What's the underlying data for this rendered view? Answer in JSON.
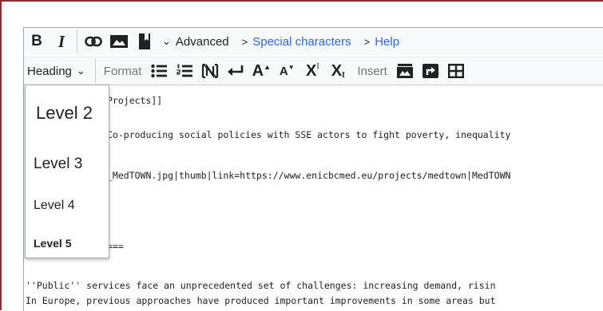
{
  "toolbar": {
    "bold_label": "B",
    "italic_label": "I",
    "advanced_label": "Advanced",
    "special_chars_label": "Special characters",
    "help_label": "Help",
    "heading_label": "Heading",
    "format_label": "Format",
    "insert_label": "Insert",
    "superscript_label": "X",
    "superscript_sup": "I",
    "subscript_label": "X",
    "subscript_sub": "I",
    "big_label": "A",
    "small_label": "A",
    "chevron_right": ">",
    "chevron_down": "⌄",
    "link_color": "#3366cc"
  },
  "heading_menu": {
    "items": [
      "Level 2",
      "Level 3",
      "Level 4",
      "Level 5"
    ]
  },
  "editor": {
    "lines": [
      "Projects]]",
      "Co-producing social policies with SSE actors to fight poverty, inequality",
      "_MedTOWN.jpg|thumb|link=https://www.enicbcmed.eu/projects/medtown|MedTOWN",
      "===",
      "''Public'' services face an unprecedented set of challenges: increasing demand, risin",
      "In Europe, previous approaches have produced important improvements in some areas but"
    ]
  }
}
